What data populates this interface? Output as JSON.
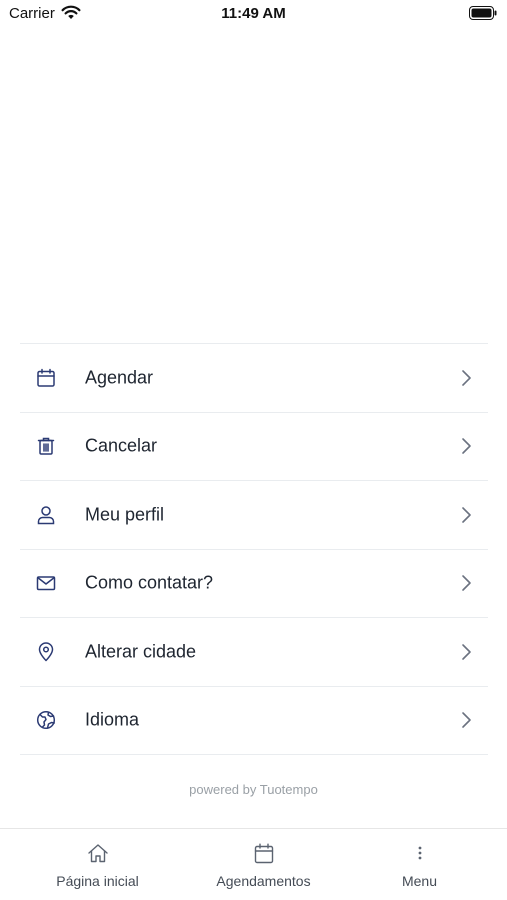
{
  "status_bar": {
    "carrier": "Carrier",
    "time": "11:49 AM"
  },
  "menu": {
    "items": [
      {
        "label": "Agendar",
        "icon": "calendar-icon"
      },
      {
        "label": "Cancelar",
        "icon": "trash-icon"
      },
      {
        "label": "Meu perfil",
        "icon": "user-icon"
      },
      {
        "label": "Como contatar?",
        "icon": "envelope-icon"
      },
      {
        "label": "Alterar cidade",
        "icon": "location-pin-icon"
      },
      {
        "label": "Idioma",
        "icon": "globe-icon"
      }
    ]
  },
  "footer": {
    "powered_by": "powered by Tuotempo"
  },
  "tab_bar": {
    "tabs": [
      {
        "label": "Página inicial",
        "icon": "home-icon"
      },
      {
        "label": "Agendamentos",
        "icon": "calendar-icon"
      },
      {
        "label": "Menu",
        "icon": "more-vertical-icon"
      }
    ]
  },
  "colors": {
    "icon": "#2b3a73",
    "text": "#1e2530",
    "divider": "#e9ecef",
    "muted": "#9aa0a6",
    "tab_icon": "#5b6370"
  }
}
